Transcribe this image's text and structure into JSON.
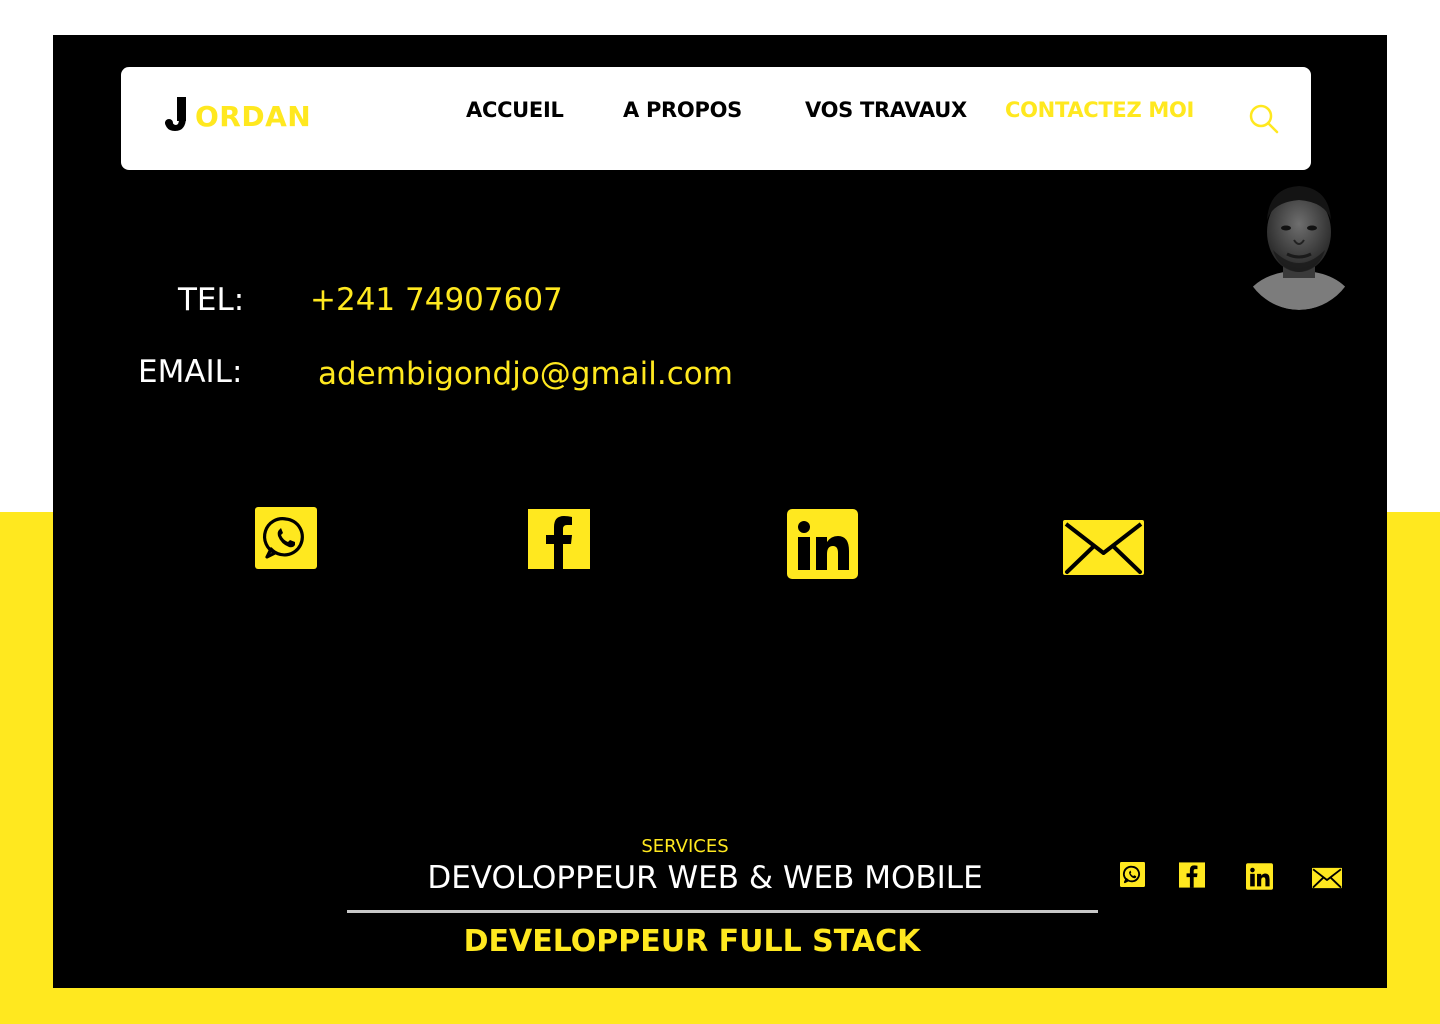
{
  "brand": {
    "initial": "J",
    "name": "ORDAN"
  },
  "nav": {
    "items": [
      {
        "label": "ACCUEIL",
        "active": false
      },
      {
        "label": "A PROPOS",
        "active": false
      },
      {
        "label": "VOS TRAVAUX",
        "active": false
      },
      {
        "label": "CONTACTEZ MOI",
        "active": true
      }
    ],
    "search_icon": "search-icon"
  },
  "contact": {
    "tel_label": "TEL:",
    "tel_value": "+241 74907607",
    "email_label": "EMAIL:",
    "email_value": "adembigondjo@gmail.com"
  },
  "social": {
    "icons": [
      "whatsapp-icon",
      "facebook-icon",
      "linkedin-icon",
      "email-icon"
    ]
  },
  "footer": {
    "services_label": "SERVICES",
    "services_title": "DEVOLOPPEUR WEB & WEB MOBILE",
    "role": "DEVELOPPEUR FULL STACK"
  },
  "colors": {
    "accent": "#FFE81F",
    "panel": "#000000",
    "navbar": "#FFFFFF"
  }
}
